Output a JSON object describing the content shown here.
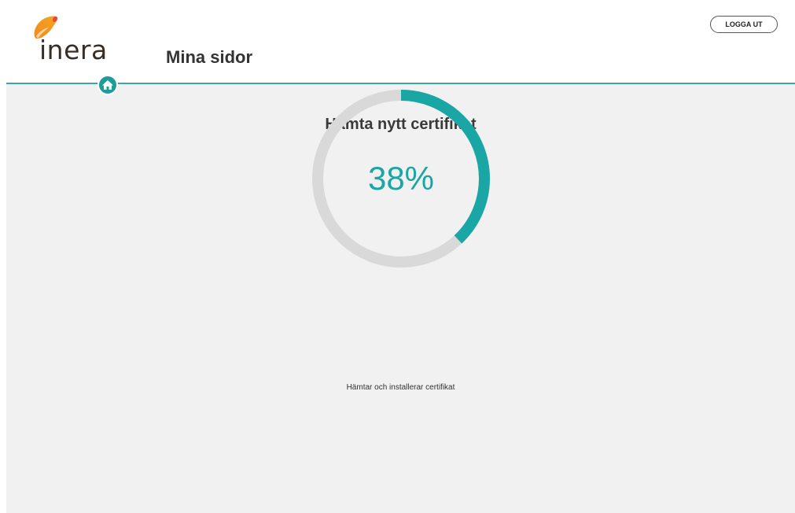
{
  "brand": {
    "logo_text": "inera",
    "logo_icon": "inera-drop-logo-icon",
    "title": "Mina sidor"
  },
  "header": {
    "logout_label": "LOGGA UT",
    "home_icon": "home-icon"
  },
  "main": {
    "heading": "Hämta nytt certifikat",
    "progress_percent": 38,
    "progress_label": "38%",
    "status_text": "Hämtar och installerar certifikat"
  },
  "colors": {
    "accent": "#1aa6a5",
    "header_line": "#3da6a8",
    "ring_track": "#d9d9d9",
    "background": "#f1f1f1"
  }
}
